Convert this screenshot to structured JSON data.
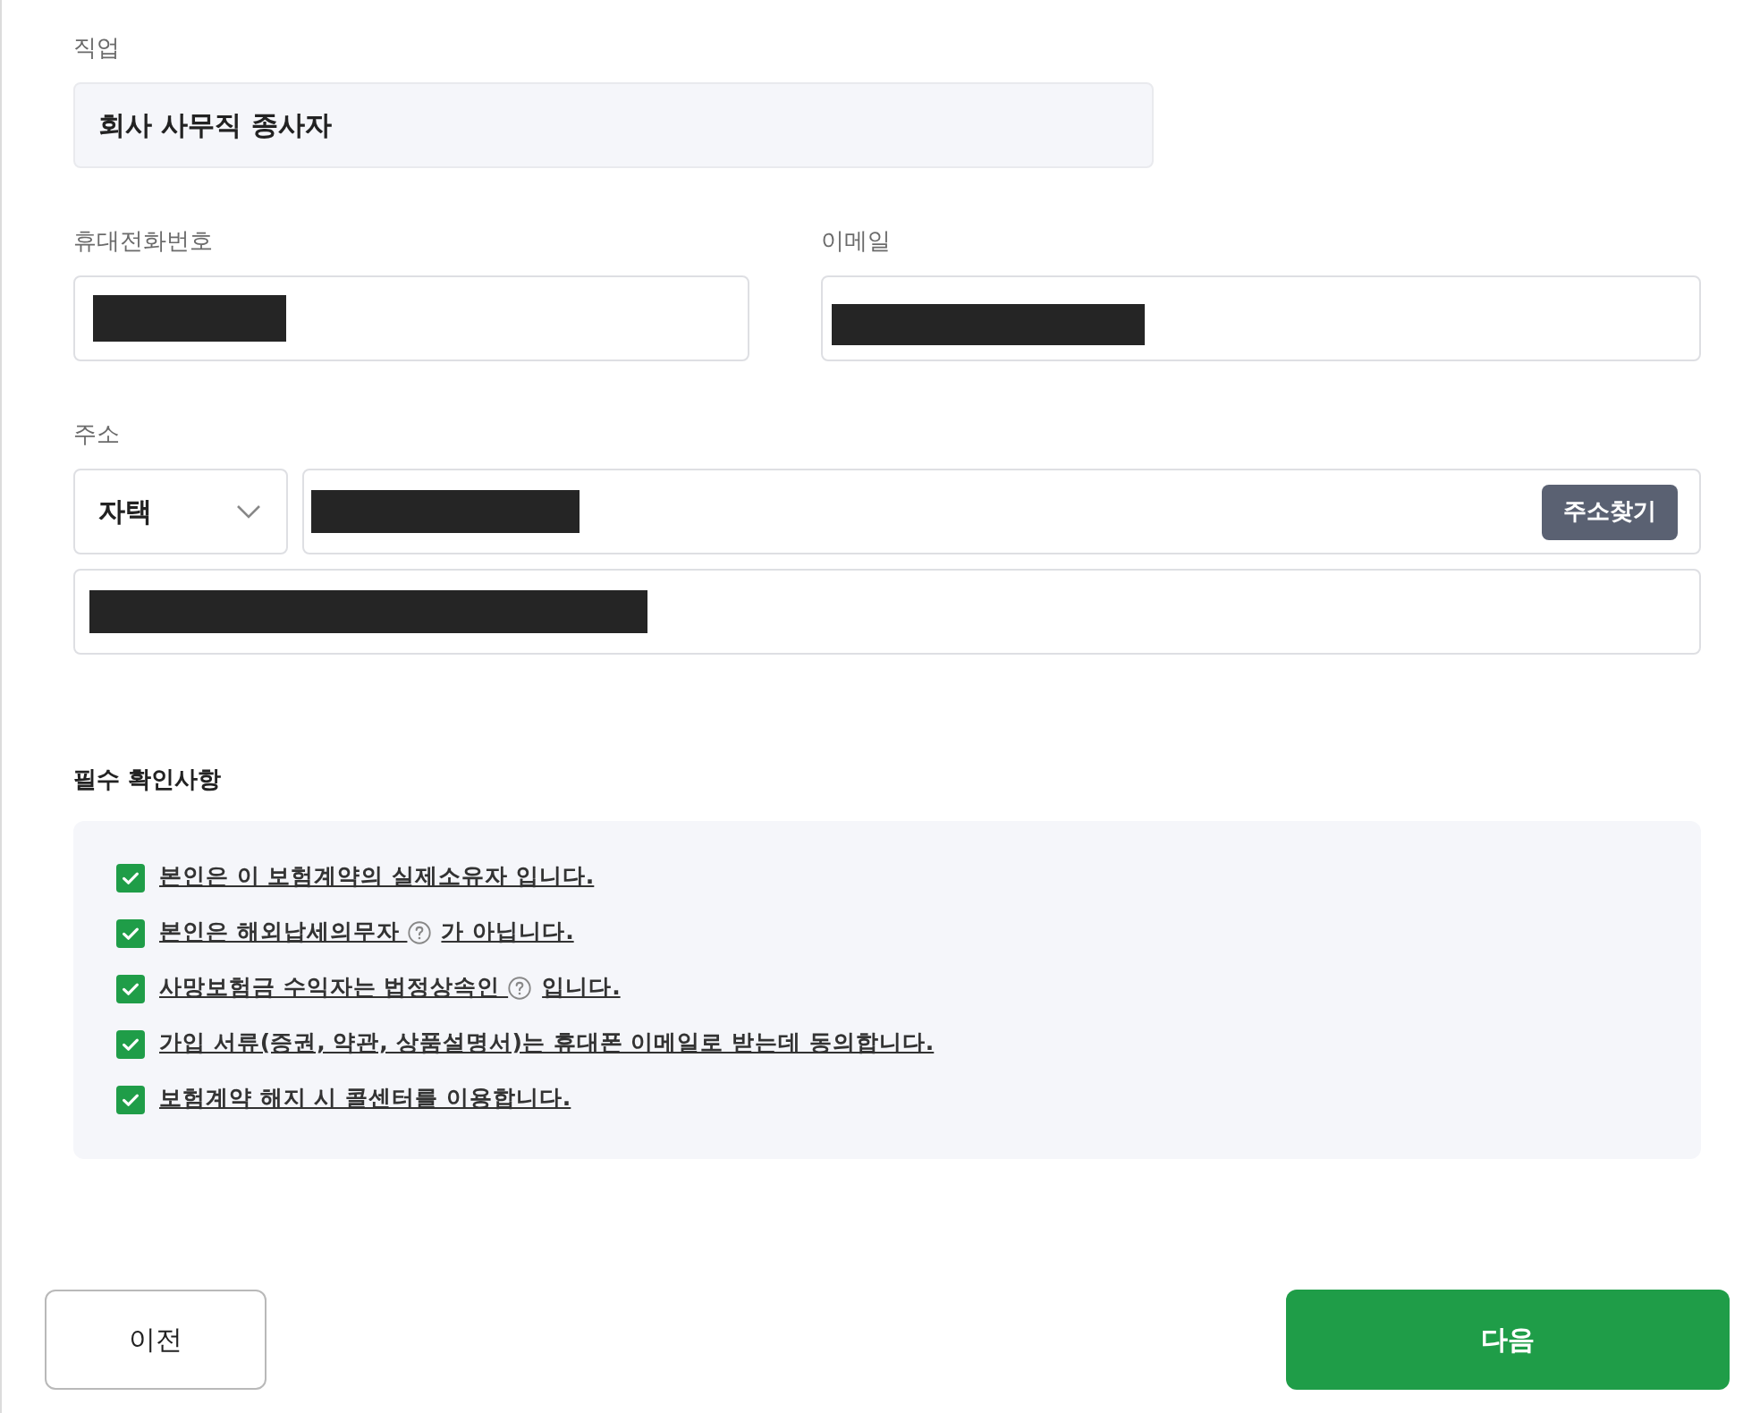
{
  "occupation": {
    "label": "직업",
    "value": "회사 사무직 종사자",
    "readonly": true
  },
  "phone": {
    "label": "휴대전화번호",
    "redacted": true
  },
  "email": {
    "label": "이메일",
    "redacted": true
  },
  "address": {
    "label": "주소",
    "type_select": {
      "value": "자택"
    },
    "line1": {
      "redacted": true
    },
    "search_button": "주소찾기",
    "line2": {
      "redacted": true
    }
  },
  "required_checks": {
    "title": "필수 확인사항",
    "items": [
      {
        "segments": [
          "본인은 이 보험계약의 실제소유자 입니다."
        ],
        "checked": true
      },
      {
        "segments": [
          "본인은 해외납세의무자 ",
          "가 아닙니다."
        ],
        "checked": true
      },
      {
        "segments": [
          "사망보험금 수익자는 법정상속인 ",
          "입니다."
        ],
        "checked": true
      },
      {
        "segments": [
          "가입 서류(증권, 약관, 상품설명서)는 휴대폰 이메일로 받는데 동의합니다."
        ],
        "checked": true
      },
      {
        "segments": [
          "보험계약 해지 시 콜센터를 이용합니다."
        ],
        "checked": true
      }
    ]
  },
  "buttons": {
    "prev": "이전",
    "next": "다음"
  }
}
